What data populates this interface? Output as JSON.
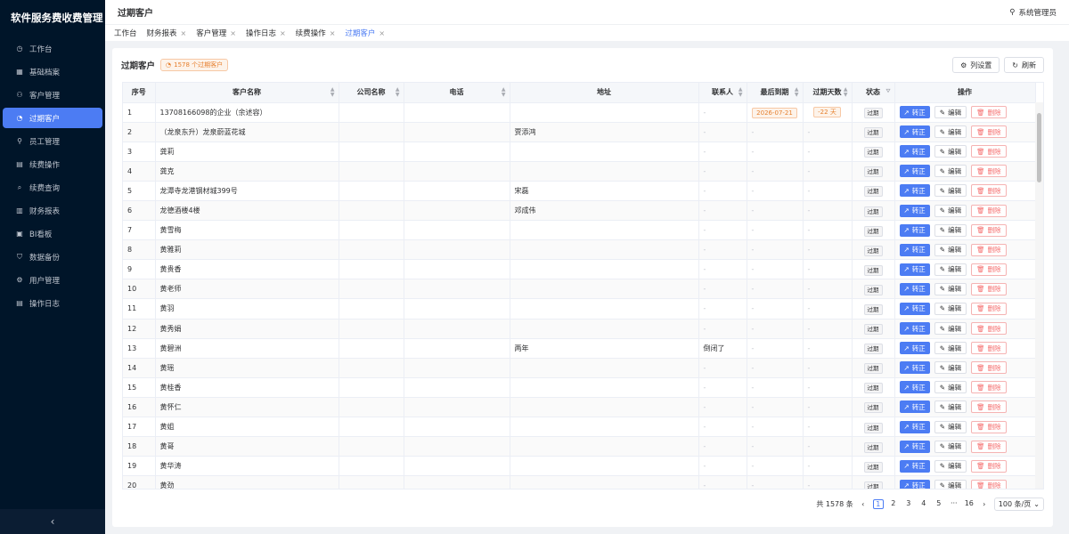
{
  "app": {
    "title": "软件服务费收费管理"
  },
  "sidebar": {
    "items": [
      {
        "label": "工作台",
        "icon": "dashboard-icon",
        "glyph": "◷",
        "active": false
      },
      {
        "label": "基础档案",
        "icon": "grid-icon",
        "glyph": "▦",
        "active": false
      },
      {
        "label": "客户管理",
        "icon": "users-icon",
        "glyph": "⚇",
        "active": false
      },
      {
        "label": "过期客户",
        "icon": "clock-icon",
        "glyph": "◔",
        "active": true
      },
      {
        "label": "员工管理",
        "icon": "user-icon",
        "glyph": "⚲",
        "active": false
      },
      {
        "label": "续费操作",
        "icon": "document-icon",
        "glyph": "▤",
        "active": false
      },
      {
        "label": "续费查询",
        "icon": "search-icon",
        "glyph": "⌕",
        "active": false
      },
      {
        "label": "财务报表",
        "icon": "bar-chart-icon",
        "glyph": "▥",
        "active": false
      },
      {
        "label": "BI看板",
        "icon": "monitor-icon",
        "glyph": "▣",
        "active": false
      },
      {
        "label": "数据备份",
        "icon": "shield-icon",
        "glyph": "⛉",
        "active": false
      },
      {
        "label": "用户管理",
        "icon": "gear-icon",
        "glyph": "⚙",
        "active": false
      },
      {
        "label": "操作日志",
        "icon": "file-icon",
        "glyph": "▤",
        "active": false
      }
    ],
    "collapse_glyph": "‹"
  },
  "header": {
    "title": "过期客户",
    "user": "系统管理员"
  },
  "tabs": [
    {
      "label": "工作台",
      "closable": false,
      "active": false
    },
    {
      "label": "财务报表",
      "closable": true,
      "active": false
    },
    {
      "label": "客户管理",
      "closable": true,
      "active": false
    },
    {
      "label": "操作日志",
      "closable": true,
      "active": false
    },
    {
      "label": "续费操作",
      "closable": true,
      "active": false
    },
    {
      "label": "过期客户",
      "closable": true,
      "active": true
    }
  ],
  "card": {
    "title": "过期客户",
    "badge": "1578 个过期客户",
    "column_settings": "列设置",
    "refresh": "刷新"
  },
  "table": {
    "columns": [
      "序号",
      "客户名称",
      "公司名称",
      "电话",
      "地址",
      "联系人",
      "最后到期",
      "过期天数",
      "状态",
      "操作"
    ],
    "empty": "-",
    "actions": {
      "fix": "转正",
      "edit": "编辑",
      "delete": "删除"
    },
    "rows": [
      {
        "no": "1",
        "name": "13708166098的企业（余述容）",
        "company": "",
        "phone": "",
        "address": "",
        "contact": "-",
        "due": "2026-07-21",
        "overdue": "-22 天",
        "status": "过期"
      },
      {
        "no": "2",
        "name": "（龙泉东升）龙泉蔚蓝花城",
        "company": "",
        "phone": "",
        "address": "贾添鸿",
        "contact": "-",
        "due": "-",
        "overdue": "-",
        "status": "过期"
      },
      {
        "no": "3",
        "name": "龚莉",
        "company": "",
        "phone": "",
        "address": "",
        "contact": "-",
        "due": "-",
        "overdue": "-",
        "status": "过期"
      },
      {
        "no": "4",
        "name": "龚克",
        "company": "",
        "phone": "",
        "address": "",
        "contact": "-",
        "due": "-",
        "overdue": "-",
        "status": "过期"
      },
      {
        "no": "5",
        "name": "龙潭寺龙港钢材城399号",
        "company": "",
        "phone": "",
        "address": "宋磊",
        "contact": "-",
        "due": "-",
        "overdue": "-",
        "status": "过期"
      },
      {
        "no": "6",
        "name": "龙德酒楼4楼",
        "company": "",
        "phone": "",
        "address": "邓成伟",
        "contact": "-",
        "due": "-",
        "overdue": "-",
        "status": "过期"
      },
      {
        "no": "7",
        "name": "黄雪梅",
        "company": "",
        "phone": "",
        "address": "",
        "contact": "-",
        "due": "-",
        "overdue": "-",
        "status": "过期"
      },
      {
        "no": "8",
        "name": "黄雅莉",
        "company": "",
        "phone": "",
        "address": "",
        "contact": "-",
        "due": "-",
        "overdue": "-",
        "status": "过期"
      },
      {
        "no": "9",
        "name": "黄贵香",
        "company": "",
        "phone": "",
        "address": "",
        "contact": "-",
        "due": "-",
        "overdue": "-",
        "status": "过期"
      },
      {
        "no": "10",
        "name": "黄老师",
        "company": "",
        "phone": "",
        "address": "",
        "contact": "-",
        "due": "-",
        "overdue": "-",
        "status": "过期"
      },
      {
        "no": "11",
        "name": "黄羽",
        "company": "",
        "phone": "",
        "address": "",
        "contact": "-",
        "due": "-",
        "overdue": "-",
        "status": "过期"
      },
      {
        "no": "12",
        "name": "黄秀娟",
        "company": "",
        "phone": "",
        "address": "",
        "contact": "-",
        "due": "-",
        "overdue": "-",
        "status": "过期"
      },
      {
        "no": "13",
        "name": "黄碧洲",
        "company": "",
        "phone": "",
        "address": "两年",
        "contact": "倒闭了",
        "due": "-",
        "overdue": "-",
        "status": "过期"
      },
      {
        "no": "14",
        "name": "黄瑶",
        "company": "",
        "phone": "",
        "address": "",
        "contact": "-",
        "due": "-",
        "overdue": "-",
        "status": "过期"
      },
      {
        "no": "15",
        "name": "黄桂香",
        "company": "",
        "phone": "",
        "address": "",
        "contact": "-",
        "due": "-",
        "overdue": "-",
        "status": "过期"
      },
      {
        "no": "16",
        "name": "黄怀仁",
        "company": "",
        "phone": "",
        "address": "",
        "contact": "-",
        "due": "-",
        "overdue": "-",
        "status": "过期"
      },
      {
        "no": "17",
        "name": "黄姐",
        "company": "",
        "phone": "",
        "address": "",
        "contact": "-",
        "due": "-",
        "overdue": "-",
        "status": "过期"
      },
      {
        "no": "18",
        "name": "黄哥",
        "company": "",
        "phone": "",
        "address": "",
        "contact": "-",
        "due": "-",
        "overdue": "-",
        "status": "过期"
      },
      {
        "no": "19",
        "name": "黄华涛",
        "company": "",
        "phone": "",
        "address": "",
        "contact": "-",
        "due": "-",
        "overdue": "-",
        "status": "过期"
      },
      {
        "no": "20",
        "name": "黄劲",
        "company": "",
        "phone": "",
        "address": "",
        "contact": "-",
        "due": "-",
        "overdue": "-",
        "status": "过期"
      }
    ]
  },
  "pagination": {
    "total": "共 1578 条",
    "pages": [
      "1",
      "2",
      "3",
      "4",
      "5",
      "···",
      "16"
    ],
    "current": "1",
    "page_size": "100 条/页"
  },
  "colors": {
    "accent": "#4c7cf3",
    "sidebar": "#001529",
    "warning": "#e6802f",
    "danger": "#f56c6c"
  }
}
